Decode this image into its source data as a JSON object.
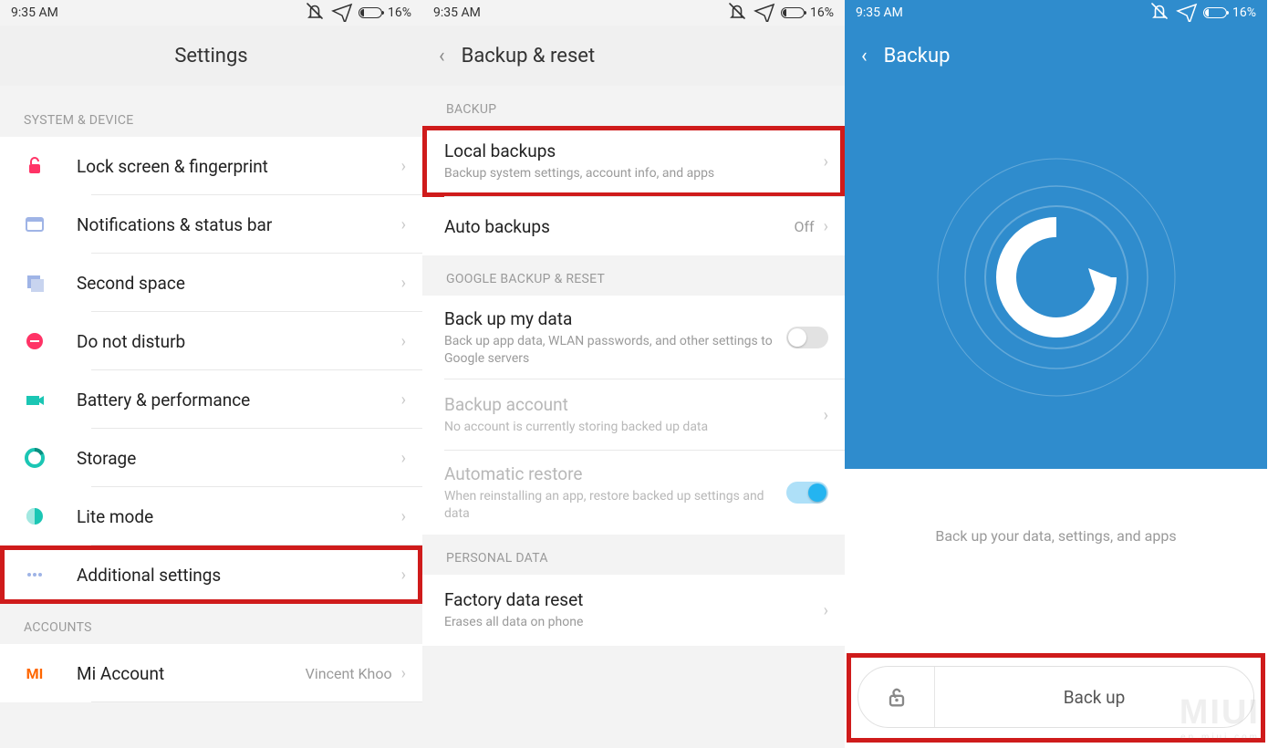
{
  "status": {
    "time": "9:35 AM",
    "battery_text": "16%",
    "battery_pct": 16
  },
  "screen1": {
    "title": "Settings",
    "sections": {
      "system_device": "SYSTEM & DEVICE",
      "accounts": "ACCOUNTS"
    },
    "items": {
      "lock": "Lock screen & fingerprint",
      "notifications": "Notifications & status bar",
      "second_space": "Second space",
      "dnd": "Do not disturb",
      "battery": "Battery & performance",
      "storage": "Storage",
      "lite": "Lite mode",
      "additional": "Additional settings",
      "mi_account": "Mi Account",
      "mi_account_value": "Vincent Khoo"
    }
  },
  "screen2": {
    "title": "Backup & reset",
    "sections": {
      "backup": "BACKUP",
      "google": "GOOGLE BACKUP & RESET",
      "personal": "PERSONAL DATA"
    },
    "items": {
      "local_backups": {
        "label": "Local backups",
        "sub": "Backup system settings, account info, and apps"
      },
      "auto_backups": {
        "label": "Auto backups",
        "value": "Off"
      },
      "backup_my_data": {
        "label": "Back up my data",
        "sub": "Back up app data, WLAN passwords, and other settings to Google servers",
        "on": false
      },
      "backup_account": {
        "label": "Backup account",
        "sub": "No account is currently storing backed up data"
      },
      "auto_restore": {
        "label": "Automatic restore",
        "sub": "When reinstalling an app, restore backed up settings and data",
        "on": true
      },
      "factory_reset": {
        "label": "Factory data reset",
        "sub": "Erases all data on phone"
      }
    }
  },
  "screen3": {
    "title": "Backup",
    "caption": "Back up your data, settings, and apps",
    "button": "Back up"
  },
  "watermark": {
    "big": "MIUI",
    "small": "en.miui.com"
  }
}
